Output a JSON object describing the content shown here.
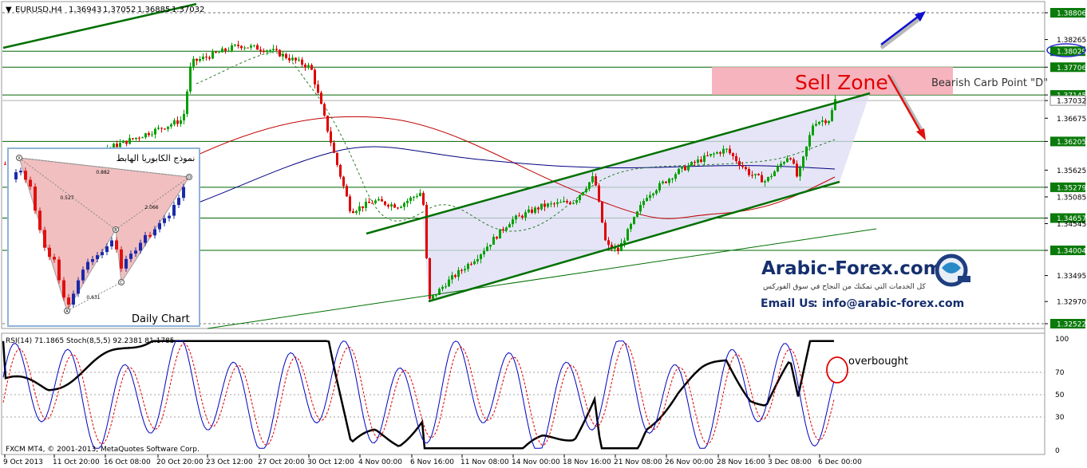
{
  "chart_data": {
    "type": "candlestick",
    "symbol_title": "EURUSD,H4",
    "ohlc_header": [
      "1.36943",
      "1.37052",
      "1.36885",
      "1.37032"
    ],
    "y_ticks": [
      "1.38806",
      "1.38265",
      "1.37706",
      "1.37145",
      "1.37032",
      "1.36675",
      "1.36205",
      "1.35625",
      "1.35279",
      "1.35085",
      "1.34657",
      "1.34545",
      "1.34004",
      "1.33495",
      "1.32970",
      "1.32522"
    ],
    "level_lines": [
      1.38806,
      1.38029,
      1.37706,
      1.37145,
      1.36205,
      1.35279,
      1.34657,
      1.34004,
      1.32522
    ],
    "highlighted_levels": [
      "1.38806",
      "1.38029",
      "1.37706",
      "1.37145",
      "1.36205",
      "1.35279",
      "1.34657",
      "1.34004",
      "1.32522"
    ],
    "circled_level": "1.38029",
    "current_price": "1.37032",
    "x_labels": [
      "9 Oct 2013",
      "11 Oct 20:00",
      "16 Oct 08:00",
      "20 Oct 20:00",
      "23 Oct 12:00",
      "27 Oct 20:00",
      "30 Oct 12:00",
      "4 Nov 00:00",
      "6 Nov 16:00",
      "11 Nov 08:00",
      "14 Nov 00:00",
      "18 Nov 16:00",
      "21 Nov 08:00",
      "26 Nov 00:00",
      "28 Nov 16:00",
      "3 Dec 08:00",
      "6 Dec 00:00"
    ],
    "annotations": {
      "sell_zone": "Sell Zone",
      "point_d": "Bearish Carb Point \"D\"",
      "overbought": "overbought",
      "watermark_brand": "Arabic-Forex.com",
      "watermark_tagline": "كل الخدمات التي تمكنك من النجاح في سوق الفوركس",
      "email_label": "Email Us",
      "email": "info@arabic-forex.com"
    },
    "inset": {
      "title": "نموذج الكابوريا الهابط",
      "caption": "Daily Chart",
      "points": [
        "X",
        "A",
        "B",
        "C",
        "D"
      ],
      "ratios": [
        "0.882",
        "0.527",
        "2.066",
        "0.631"
      ]
    },
    "indicator": {
      "header": "RSI(14) 71.1865  Stoch(8,5,5) 92.2381 81.1785",
      "levels": [
        "100",
        "70",
        "50",
        "30",
        "0"
      ],
      "rsi_last": 71.1865,
      "stoch_main_last": 92.2381,
      "stoch_signal_last": 81.1785
    },
    "footer": "FXCM MT4, © 2001-2013, MetaQuotes Software Corp.",
    "colors": {
      "bull": "#00a000",
      "bear": "#e00000",
      "level": "#006400",
      "sell_zone": "#f4a7b3",
      "sma_red": "#c00000",
      "sma_blue": "#000080",
      "stoch_main": "#0000c0",
      "stoch_signal": "#e00000"
    }
  }
}
